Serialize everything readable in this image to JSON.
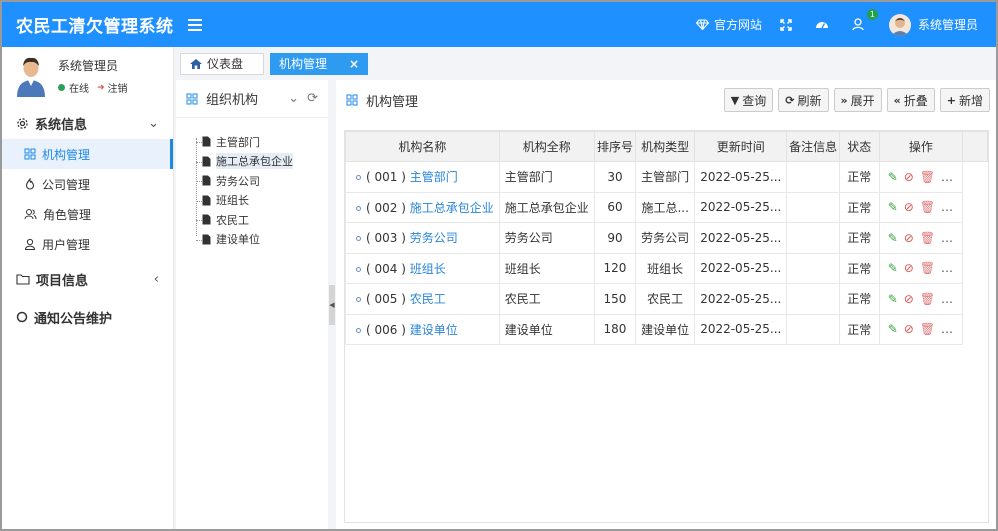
{
  "header": {
    "title": "农民工清欠管理系统",
    "official_site": "官方网站",
    "user": "系统管理员",
    "notification_count": "1"
  },
  "sidebar": {
    "user_name": "系统管理员",
    "status": "在线",
    "logout": "注销",
    "group_system": "系统信息",
    "items": [
      {
        "label": "机构管理"
      },
      {
        "label": "公司管理"
      },
      {
        "label": "角色管理"
      },
      {
        "label": "用户管理"
      }
    ],
    "group_project": "项目信息",
    "group_notice": "通知公告维护"
  },
  "tabs": {
    "dashboard": "仪表盘",
    "org": "机构管理"
  },
  "org_panel": {
    "title": "组织机构",
    "nodes": [
      "主管部门",
      "施工总承包企业",
      "劳务公司",
      "班组长",
      "农民工",
      "建设单位"
    ]
  },
  "main": {
    "title": "机构管理",
    "toolbar": {
      "query": "查询",
      "refresh": "刷新",
      "expand": "展开",
      "collapse": "折叠",
      "add": "新增"
    },
    "columns": [
      "机构名称",
      "机构全称",
      "排序号",
      "机构类型",
      "更新时间",
      "备注信息",
      "状态",
      "操作"
    ],
    "rows": [
      {
        "code": "( 001 )",
        "name": "主管部门",
        "full": "主管部门",
        "sort": "30",
        "type": "主管部门",
        "time": "2022-05-25...",
        "note": "",
        "status": "正常"
      },
      {
        "code": "( 002 )",
        "name": "施工总承包企业",
        "full": "施工总承包企业",
        "sort": "60",
        "type": "施工总...",
        "time": "2022-05-25...",
        "note": "",
        "status": "正常"
      },
      {
        "code": "( 003 )",
        "name": "劳务公司",
        "full": "劳务公司",
        "sort": "90",
        "type": "劳务公司",
        "time": "2022-05-25...",
        "note": "",
        "status": "正常"
      },
      {
        "code": "( 004 )",
        "name": "班组长",
        "full": "班组长",
        "sort": "120",
        "type": "班组长",
        "time": "2022-05-25...",
        "note": "",
        "status": "正常"
      },
      {
        "code": "( 005 )",
        "name": "农民工",
        "full": "农民工",
        "sort": "150",
        "type": "农民工",
        "time": "2022-05-25...",
        "note": "",
        "status": "正常"
      },
      {
        "code": "( 006 )",
        "name": "建设单位",
        "full": "建设单位",
        "sort": "180",
        "type": "建设单位",
        "time": "2022-05-25...",
        "note": "",
        "status": "正常"
      }
    ]
  },
  "colors": {
    "header": "#1e90ff",
    "accent": "#1e88e5",
    "active_tab": "#2e9bf0"
  }
}
